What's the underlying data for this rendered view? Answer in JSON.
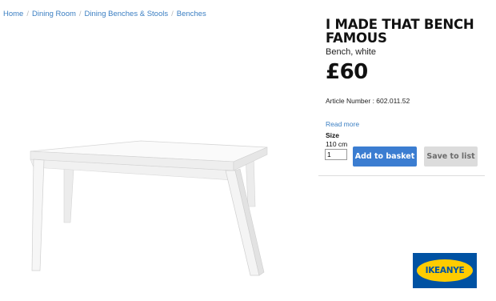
{
  "breadcrumb": [
    "Home",
    "Dining Room",
    "Dining Benches & Stools",
    "Benches"
  ],
  "product": {
    "title_line1": "I MADE THAT BENCH",
    "title_line2": "FAMOUS",
    "subtitle": "Bench, white",
    "price": "£60",
    "article": "Article Number : 602.011.52",
    "read_more": "Read more",
    "size_label": "Size",
    "size_value": "110 cm"
  },
  "purchase": {
    "quantity": "1",
    "add_label": "Add to basket",
    "save_label": "Save to list",
    "add_color": "#3b7dd1",
    "save_color": "#dcdcdc"
  },
  "logo": {
    "text": "IKEANYE",
    "background": "#0052a3",
    "oval": "#ffcc00"
  }
}
